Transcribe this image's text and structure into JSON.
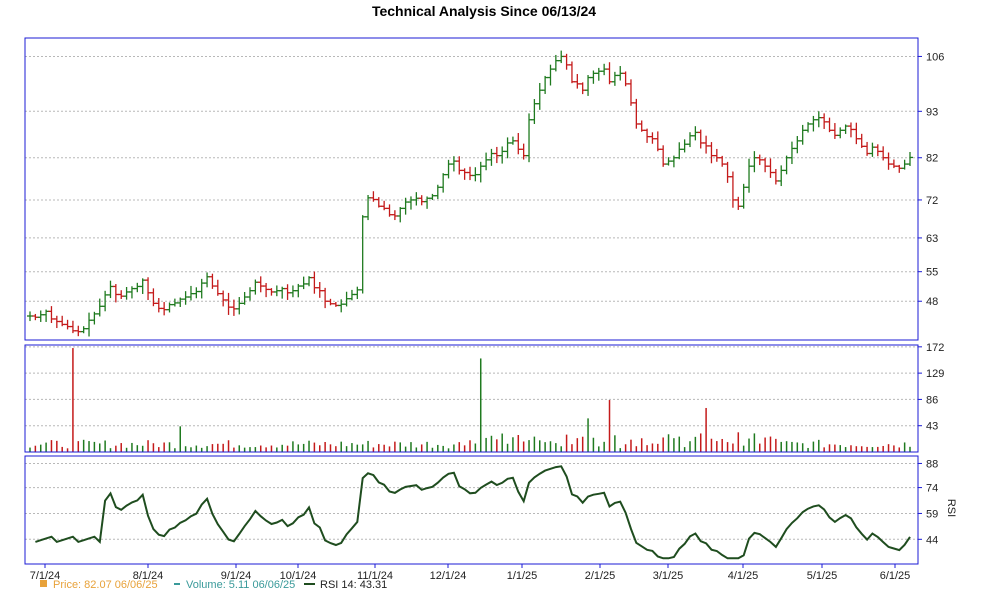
{
  "chart_data": {
    "type": "ohlc",
    "title": "Technical Analysis Since 06/13/24",
    "x_ticks": [
      "7/1/24",
      "8/1/24",
      "9/1/24",
      "10/1/24",
      "11/1/24",
      "12/1/24",
      "1/1/25",
      "2/1/25",
      "3/1/25",
      "4/1/25",
      "5/1/25",
      "6/1/25"
    ],
    "price": {
      "y_ticks": [
        106,
        93,
        82,
        72,
        63,
        55,
        48
      ],
      "ylim": [
        40,
        108
      ],
      "closes": [
        44.5,
        44.2,
        44.8,
        45.6,
        43.8,
        43.2,
        42.5,
        42.0,
        41.0,
        40.8,
        41.5,
        43.5,
        45.0,
        46.8,
        49.5,
        51.5,
        49.6,
        49.2,
        50.2,
        51.0,
        51.5,
        53.0,
        50.0,
        47.5,
        46.3,
        46.0,
        47.2,
        47.6,
        48.5,
        49.0,
        49.8,
        50.3,
        52.3,
        53.8,
        51.6,
        49.8,
        48.3,
        46.6,
        46.2,
        47.5,
        49.0,
        50.5,
        52.5,
        51.6,
        50.8,
        50.2,
        50.5,
        51.0,
        50.0,
        50.5,
        51.6,
        52.1,
        53.6,
        51.2,
        50.5,
        48.0,
        47.4,
        47.0,
        47.3,
        48.6,
        49.6,
        50.7,
        68.0,
        72.5,
        72.1,
        70.5,
        70.0,
        68.5,
        68.2,
        70.0,
        71.5,
        72.0,
        72.4,
        71.6,
        72.4,
        73.0,
        75.0,
        78.0,
        80.5,
        81.2,
        79.0,
        78.5,
        77.8,
        78.0,
        80.0,
        81.5,
        83.0,
        82.5,
        83.5,
        85.5,
        86.0,
        84.0,
        82.5,
        91.0,
        94.8,
        98.0,
        101.0,
        103.0,
        105.0,
        106.0,
        104.0,
        100.0,
        99.5,
        98.0,
        101.0,
        102.0,
        102.5,
        103.0,
        100.0,
        101.5,
        102.0,
        99.5,
        95.0,
        90.0,
        88.5,
        87.0,
        86.5,
        84.0,
        80.5,
        81.2,
        82.0,
        84.0,
        85.2,
        87.2,
        88.0,
        85.5,
        84.8,
        82.5,
        82.0,
        80.5,
        77.5,
        72.0,
        70.5,
        75.0,
        80.0,
        82.0,
        81.5,
        80.0,
        78.5,
        76.5,
        79.0,
        82.0,
        84.2,
        86.0,
        88.5,
        90.0,
        91.0,
        91.5,
        90.5,
        88.5,
        87.3,
        88.5,
        89.5,
        88.7,
        86.5,
        84.7,
        83.0,
        84.5,
        83.5,
        82.0,
        80.5,
        80.0,
        79.5,
        80.5,
        82.07
      ],
      "volume_note": "daily bars red/green"
    },
    "volume": {
      "y_ticks": [
        172,
        129,
        86,
        43
      ],
      "ylim": [
        0,
        175
      ],
      "spikes": [
        {
          "i": 8,
          "v": 170
        },
        {
          "i": 28,
          "v": 42
        },
        {
          "i": 84,
          "v": 153
        },
        {
          "i": 104,
          "v": 55
        },
        {
          "i": 108,
          "v": 85
        },
        {
          "i": 126,
          "v": 72
        }
      ]
    },
    "rsi": {
      "y_ticks": [
        88,
        74,
        59,
        44
      ],
      "ylim": [
        32,
        90
      ],
      "ylabel": "RSI"
    },
    "legend": [
      {
        "swatch": "orange-square",
        "label": "Price: 82.07  06/06/25",
        "color": "#e8a23a"
      },
      {
        "swatch": "teal-dash",
        "label": "Volume: 5.11  06/06/25",
        "color": "#3a9a9a"
      },
      {
        "swatch": "green-line",
        "label": "RSI 14: 43.31",
        "color": "#1f4d1f"
      }
    ]
  }
}
